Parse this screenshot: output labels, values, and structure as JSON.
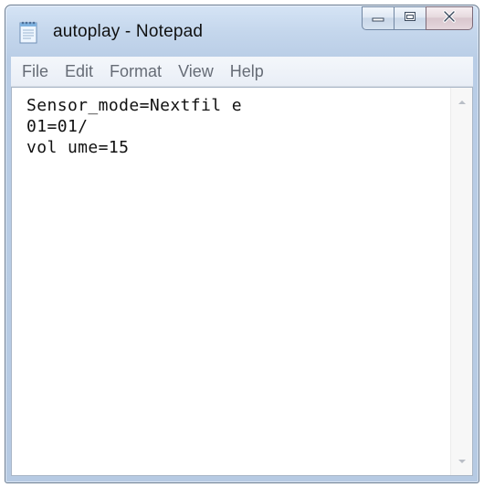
{
  "window": {
    "title": "autoplay - Notepad",
    "app_icon": "notepad-icon"
  },
  "caption_buttons": {
    "minimize_icon": "minimize-icon",
    "maximize_icon": "maximize-icon",
    "close_icon": "close-icon"
  },
  "menu": {
    "items": [
      {
        "label": "File"
      },
      {
        "label": "Edit"
      },
      {
        "label": "Format"
      },
      {
        "label": "View"
      },
      {
        "label": "Help"
      }
    ]
  },
  "editor": {
    "lines": [
      "Sensor_mode=Nextfil e",
      "01=01/",
      "vol ume=15"
    ]
  },
  "scrollbar": {
    "up_icon": "scroll-up-arrow-icon",
    "down_icon": "scroll-down-arrow-icon"
  },
  "colors": {
    "frame": "#c4d6ec",
    "menubar": "#eef2f8",
    "menu_text": "#666c76",
    "close_button": "#e4d6dc"
  }
}
